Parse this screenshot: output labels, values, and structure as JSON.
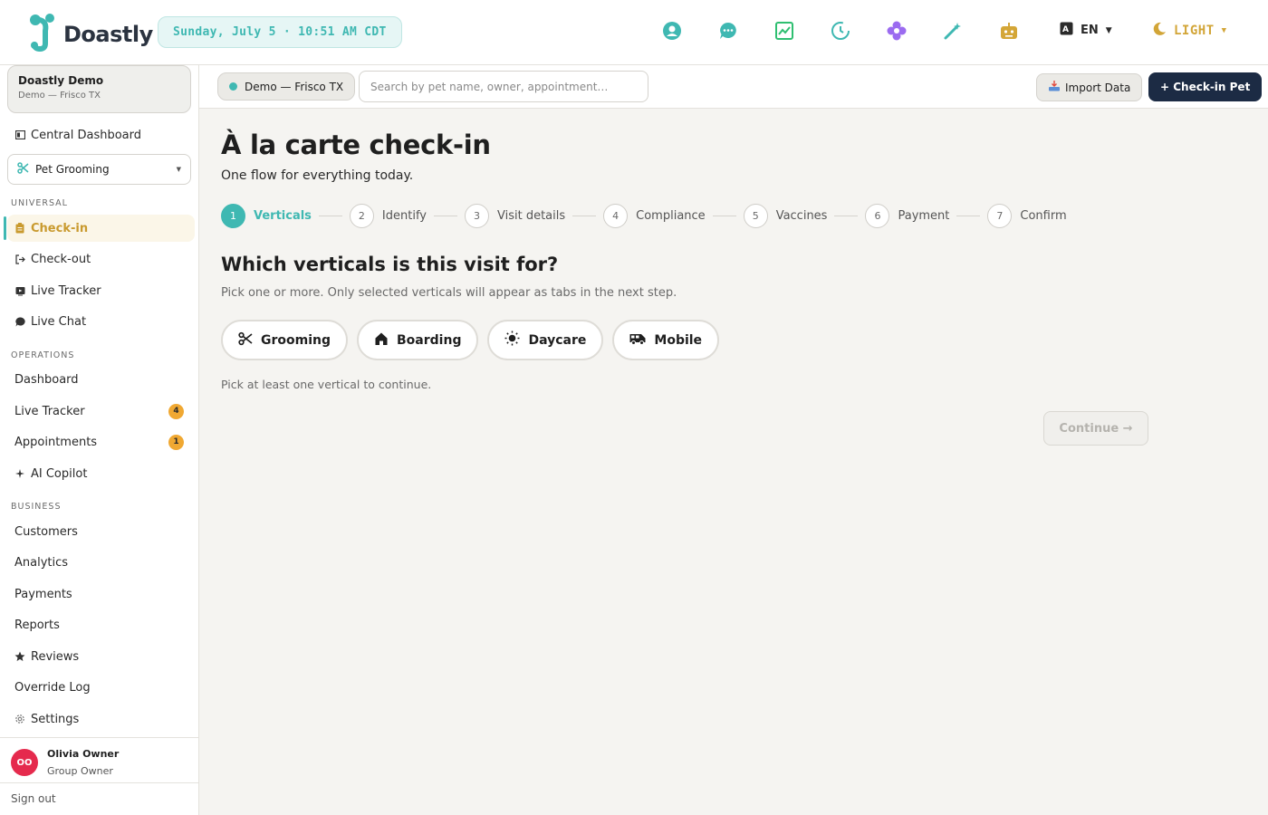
{
  "app": {
    "name": "Doastly",
    "clock": "Sunday, July 5 · 10:51 AM CDT",
    "language": "EN",
    "theme": "LIGHT",
    "accent_color": "#3fb8b2",
    "primary_color": "#1c2b44",
    "header_icons": [
      "profile-icon",
      "chat-icon",
      "image-icon",
      "clock-icon",
      "flower-icon",
      "magic-wand-icon",
      "robot-icon"
    ]
  },
  "sidebar": {
    "org_name": "Doastly Demo",
    "org_location": "Demo — Frisco TX",
    "central_dashboard": "Central Dashboard",
    "vertical_select": "Pet Grooming",
    "sections": {
      "universal": "UNIVERSAL",
      "operations": "OPERATIONS",
      "business": "BUSINESS"
    },
    "universal_items": [
      "Check-in",
      "Check-out",
      "Live Tracker",
      "Live Chat"
    ],
    "operations_items": [
      "Dashboard",
      "Live Tracker",
      "Appointments",
      "AI Copilot"
    ],
    "operations_badges": {
      "live_tracker": "4",
      "appointments": "1"
    },
    "business_items": [
      "Customers",
      "Analytics",
      "Payments",
      "Reports",
      "Reviews",
      "Override Log",
      "Settings"
    ],
    "user": {
      "initials": "OO",
      "name": "Olivia Owner",
      "role": "Group Owner"
    },
    "sign_out": "Sign out"
  },
  "header": {
    "location_chip": "Demo — Frisco TX",
    "search_placeholder": "Search by pet name, owner, appointment…",
    "import_label": "Import Data",
    "checkin_label": "+ Check-in Pet"
  },
  "main": {
    "title": "À la carte check-in",
    "subtitle": "One flow for everything today.",
    "steps": [
      {
        "num": "1",
        "label": "Verticals"
      },
      {
        "num": "2",
        "label": "Identify"
      },
      {
        "num": "3",
        "label": "Visit details"
      },
      {
        "num": "4",
        "label": "Compliance"
      },
      {
        "num": "5",
        "label": "Vaccines"
      },
      {
        "num": "6",
        "label": "Payment"
      },
      {
        "num": "7",
        "label": "Confirm"
      }
    ],
    "active_step": 1,
    "question": "Which verticals is this visit for?",
    "question_hint": "Pick one or more. Only selected verticals will appear as tabs in the next step.",
    "verticals": [
      {
        "label": "Grooming",
        "icon": "scissors-icon"
      },
      {
        "label": "Boarding",
        "icon": "house-icon"
      },
      {
        "label": "Daycare",
        "icon": "sun-icon"
      },
      {
        "label": "Mobile",
        "icon": "van-icon"
      }
    ],
    "pick_message": "Pick at least one vertical to continue.",
    "continue_label": "Continue →"
  }
}
